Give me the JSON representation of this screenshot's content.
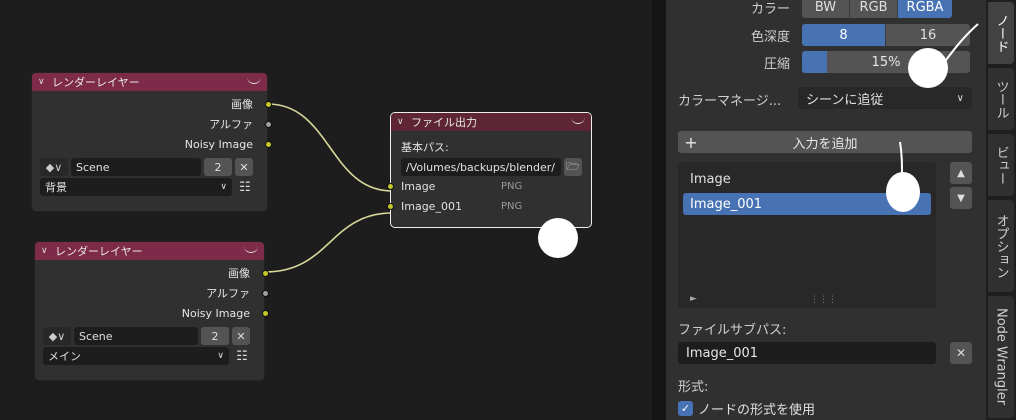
{
  "render_layer_1": {
    "title": "レンダーレイヤー",
    "outputs": [
      "画像",
      "アルファ",
      "Noisy Image"
    ],
    "scene": "Scene",
    "scene_users": "2",
    "layer": "背景"
  },
  "render_layer_2": {
    "title": "レンダーレイヤー",
    "outputs": [
      "画像",
      "アルファ",
      "Noisy Image"
    ],
    "scene": "Scene",
    "scene_users": "2",
    "layer": "メイン"
  },
  "file_output": {
    "title": "ファイル出力",
    "base_path_label": "基本パス:",
    "base_path": "/Volumes/backups/blender/",
    "inputs": [
      {
        "name": "Image",
        "format": "PNG"
      },
      {
        "name": "Image_001",
        "format": "PNG"
      }
    ]
  },
  "sidebar": {
    "color_label": "カラー",
    "color_modes": [
      "BW",
      "RGB",
      "RGBA"
    ],
    "color_mode_active": "RGBA",
    "depth_label": "色深度",
    "depth_options": [
      "8",
      "16"
    ],
    "depth_active": "8",
    "compression_label": "圧縮",
    "compression_value": "15%",
    "compression_fraction": 0.15,
    "color_management_label": "カラーマネージ...",
    "color_management_value": "シーンに追従",
    "add_input_label": "入力を追加",
    "inputs_list": [
      "Image",
      "Image_001"
    ],
    "inputs_selected": "Image_001",
    "file_subpath_label": "ファイルサブパス:",
    "file_subpath": "Image_001",
    "format_label": "形式:",
    "use_node_format_label": "ノードの形式を使用",
    "use_node_format": true
  },
  "tabs": [
    "ノード",
    "ツール",
    "ビュー",
    "オプション",
    "Node Wrangler"
  ],
  "active_tab": "ノード",
  "colors": {
    "accent": "#4772b3",
    "header_render_layer": "#7d2b48",
    "header_output": "#5e2535",
    "socket_color": "#c7c729",
    "socket_float": "#a1a1a1"
  }
}
